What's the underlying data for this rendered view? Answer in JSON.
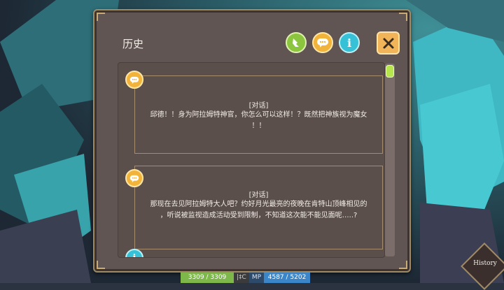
{
  "panel": {
    "title": "历史"
  },
  "header_buttons": {
    "info_glyph": "i"
  },
  "entries": [
    {
      "type": "dialogue",
      "icon": "speech-bubble-icon",
      "tag": "[对话]",
      "lines": [
        "邱德！！身为阿拉姆特神官，你怎么可以这样！？既然把神族视为魔女",
        "！！"
      ]
    },
    {
      "type": "dialogue",
      "icon": "speech-bubble-icon",
      "tag": "[对话]",
      "lines": [
        "那现在去见阿拉姆特大人吧？约好月光最亮的夜晚在肯特山顶峰相见的",
        "，听说被监视造成活动受到限制，不知道这次能不能见面呢…..?"
      ]
    },
    {
      "type": "info",
      "icon": "info-icon",
      "glyph": "i"
    }
  ],
  "hud": {
    "hp": "3309 / 3309",
    "sep": "|‡C",
    "mp_label": "MP",
    "mp": "4587 / 5202"
  },
  "history_button": {
    "label": "History"
  },
  "colors": {
    "panel": "#615553",
    "frame": "#a08a66",
    "accent_green": "#8cc63f",
    "accent_orange": "#f2b33a",
    "accent_teal": "#36c1d6"
  }
}
